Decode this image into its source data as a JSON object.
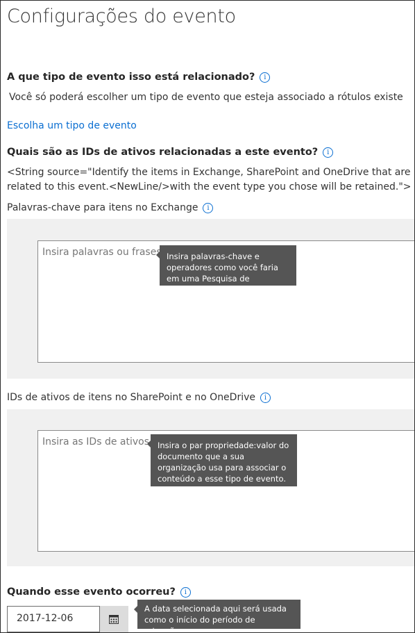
{
  "page": {
    "title": "Configurações do evento"
  },
  "event_type": {
    "question": "A que tipo de evento isso está relacionado?",
    "description": "Você só poderá escolher um tipo de evento que esteja associado a rótulos existe",
    "link": "Escolha um tipo de evento"
  },
  "asset_ids": {
    "question": "Quais são as IDs de ativos relacionadas a este evento?",
    "string_text": "<String source=\"Identify the items in Exchange, SharePoint and OneDrive that are related to this event.<NewLine/>with the event type you chose will be retained.\">"
  },
  "exchange": {
    "label": "Palavras-chave para itens no Exchange",
    "placeholder": "Insira palavras ou frases",
    "tooltip": "Insira palavras-chave e operadores como você faria em uma Pesquisa de Conteúdo."
  },
  "sharepoint": {
    "label": "IDs de ativos de itens no SharePoint e no OneDrive",
    "placeholder": "Insira as IDs de ativos",
    "tooltip": "Insira o par propriedade:valor do documento que a sua organização usa para associar o conteúdo a esse tipo de evento."
  },
  "event_date": {
    "question": "Quando esse evento ocorreu?",
    "value": "2017-12-06",
    "tooltip": "A data selecionada aqui será usada como o início do período de retenção."
  },
  "icons": {
    "info": "info-icon",
    "calendar": "calendar-icon",
    "info_glyph": "i"
  },
  "colors": {
    "link": "#0a6ed1",
    "tooltip_bg": "#555555",
    "panel_bg": "#f0f0f0"
  }
}
